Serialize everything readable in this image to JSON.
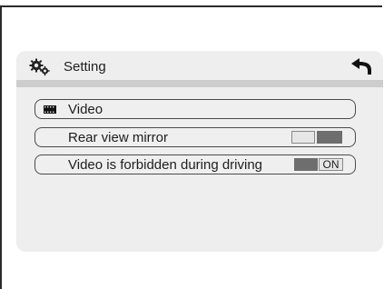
{
  "header": {
    "title": "Setting",
    "settings_icon": "gears-icon",
    "back_icon": "back-arrow-icon"
  },
  "rows": [
    {
      "label": "Video",
      "icon": "video-film-icon"
    },
    {
      "label": "Rear view mirror",
      "toggle": "off"
    },
    {
      "label": "Video is forbidden during driving",
      "toggle": "on",
      "toggle_text": "ON"
    }
  ],
  "colors": {
    "panel": "#eeeeee",
    "header_bar": "#cdcdcd",
    "toggle_dark": "#6e6e6e",
    "toggle_light": "#e6e6e6"
  }
}
